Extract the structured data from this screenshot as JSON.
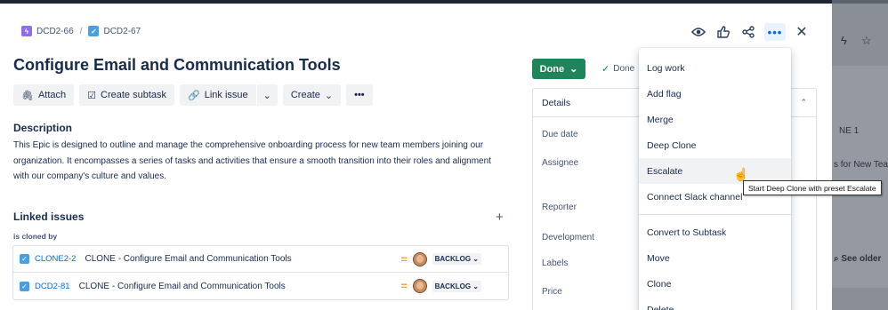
{
  "breadcrumb": {
    "parent_key": "DCD2-66",
    "separator": "/",
    "issue_key": "DCD2-67"
  },
  "top_actions": {
    "watch": "eye-icon",
    "vote": "thumbs-up-icon",
    "share": "share-icon",
    "more": "•••",
    "close": "✕"
  },
  "issue": {
    "title": "Configure Email and Communication Tools",
    "description_heading": "Description",
    "description": "This Epic is designed to outline and manage the comprehensive onboarding process for new team members joining our organization. It encompasses a series of tasks and activities that ensure a smooth transition into their roles and alignment with our company's culture and values."
  },
  "toolbar": {
    "attach": "Attach",
    "create_subtask": "Create subtask",
    "link_issue": "Link issue",
    "create": "Create",
    "more": "•••"
  },
  "linked_issues": {
    "heading": "Linked issues",
    "add": "+",
    "relation": "is cloned by",
    "rows": [
      {
        "key": "CLONE2-2",
        "summary": "CLONE - Configure Email and Communication Tools",
        "status": "BACKLOG"
      },
      {
        "key": "DCD2-81",
        "summary": "CLONE - Configure Email and Communication Tools",
        "status": "BACKLOG"
      }
    ]
  },
  "status": {
    "button": "Done",
    "resolution": "Done"
  },
  "details": {
    "heading": "Details",
    "fields": [
      "Due date",
      "Assignee",
      "Reporter",
      "Development",
      "Labels",
      "Price"
    ]
  },
  "menu": {
    "items": [
      "Log work",
      "Add flag",
      "Merge",
      "Deep Clone",
      "Escalate",
      "Connect Slack channel",
      "Convert to Subtask",
      "Move",
      "Clone",
      "Delete"
    ],
    "hovered": "Escalate"
  },
  "tooltip": "Start Deep Clone with preset Escalate",
  "background": {
    "col_header": "NE 1",
    "row_text": "s for New Tea",
    "see_older": "See older"
  },
  "colors": {
    "primary_green": "#1f845a",
    "link_blue": "#0c66e4",
    "epic_purple": "#8f6ee8",
    "task_blue": "#4b9fe0",
    "priority_medium": "#e2a03f"
  }
}
